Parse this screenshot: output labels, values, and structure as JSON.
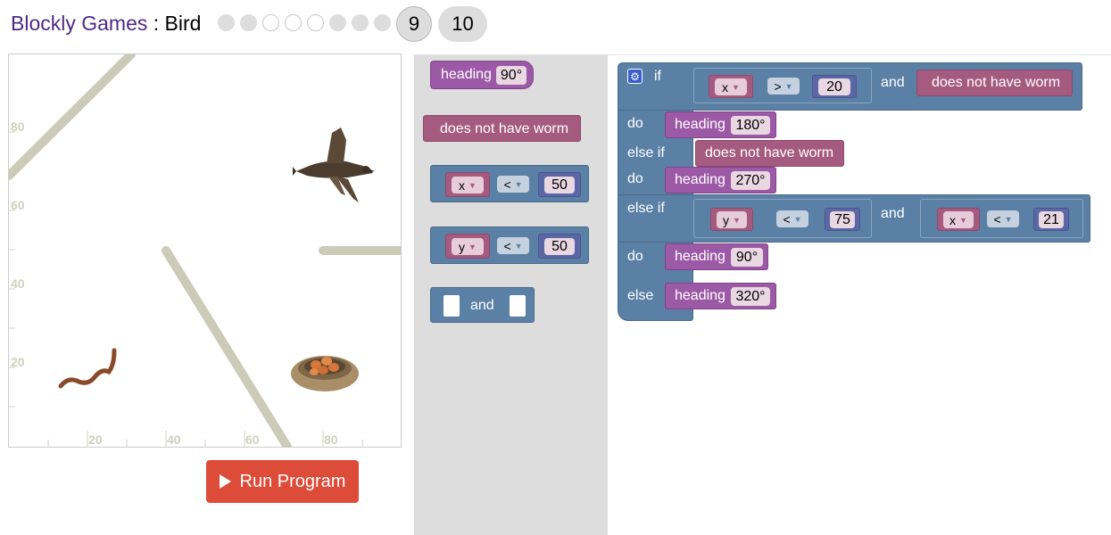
{
  "header": {
    "app_name": "Blockly Games",
    "separator": " : ",
    "game_name": "Bird",
    "levels": [
      {
        "state": "done"
      },
      {
        "state": "done"
      },
      {
        "state": "todo"
      },
      {
        "state": "todo"
      },
      {
        "state": "todo"
      },
      {
        "state": "done"
      },
      {
        "state": "done"
      },
      {
        "state": "done"
      }
    ],
    "current_level": "9",
    "next_level": "10"
  },
  "game": {
    "y_ticks": [
      "80",
      "60",
      "40",
      "20"
    ],
    "x_ticks": [
      "20",
      "40",
      "60",
      "80"
    ],
    "run_button": "Run Program"
  },
  "toolbox": {
    "heading_block": {
      "label": "heading",
      "value": "90°"
    },
    "no_worm_block": {
      "label": "does not have worm"
    },
    "compare_x": {
      "var": "x",
      "op": "<",
      "value": "50"
    },
    "compare_y": {
      "var": "y",
      "op": "<",
      "value": "50"
    },
    "and_block": {
      "label": "and"
    }
  },
  "workspace": {
    "if_label": "if",
    "do_label": "do",
    "else_if_label": "else if",
    "else_label": "else",
    "and_label": "and",
    "heading_label": "heading",
    "no_worm_label": "does not have worm",
    "cond1": {
      "var": "x",
      "op": ">",
      "value": "20"
    },
    "do1_heading": "180°",
    "do2_heading": "270°",
    "cond3a": {
      "var": "y",
      "op": "<",
      "value": "75"
    },
    "cond3b": {
      "var": "x",
      "op": "<",
      "value": "21"
    },
    "do3_heading": "90°",
    "else_heading": "320°"
  },
  "colors": {
    "brand": "#4e2a84",
    "run_button": "#dd4b39",
    "logic_block": "#5b80a5",
    "heading_block": "#9c59a6",
    "worm_block": "#a55b80",
    "number_block": "#5b67a5",
    "wall": "#cccbb8"
  }
}
